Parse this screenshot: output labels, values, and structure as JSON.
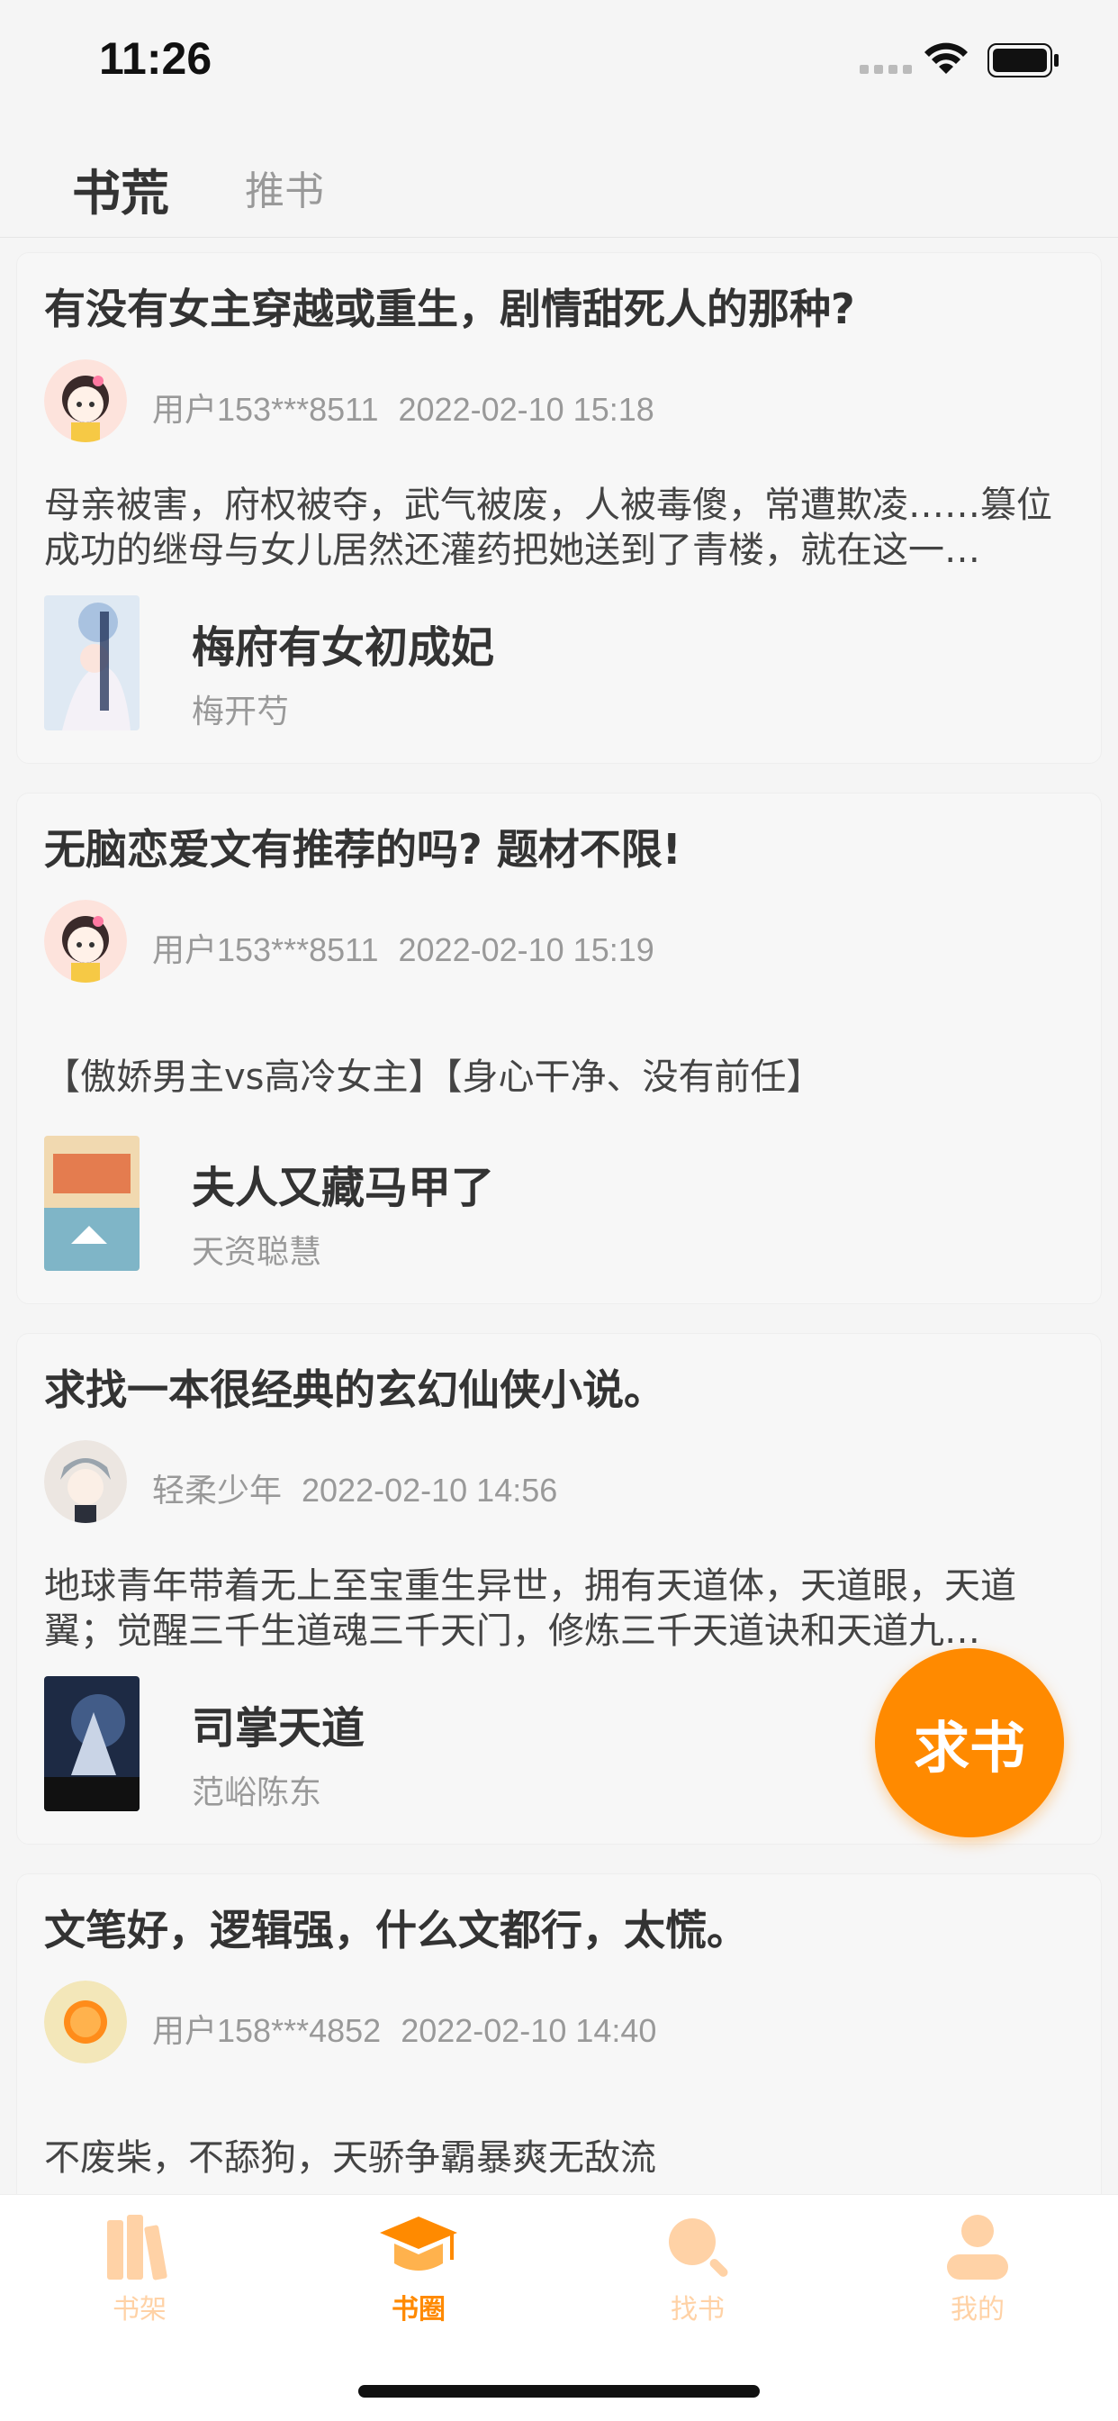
{
  "status_bar": {
    "time": "11:26"
  },
  "header": {
    "tabs": [
      "书荒",
      "推书"
    ],
    "active_tab": 0
  },
  "posts": [
    {
      "title": "有没有女主穿越或重生，剧情甜死人的那种?",
      "user": "用户153***8511",
      "date": "2022-02-10 15:18",
      "excerpt": "母亲被害，府权被夺，武气被废，人被毒傻，常遭欺凌……篡位成功的继母与女儿居然还灌药把她送到了青楼，就在这一…",
      "book": {
        "title": "梅府有女初成妃",
        "author": "梅开芍"
      }
    },
    {
      "title": "无脑恋爱文有推荐的吗? 题材不限!",
      "user": "用户153***8511",
      "date": "2022-02-10 15:19",
      "excerpt": "【傲娇男主vs高冷女主】【身心干净、没有前任】",
      "book": {
        "title": "夫人又藏马甲了",
        "author": "天资聪慧"
      }
    },
    {
      "title": "求找一本很经典的玄幻仙侠小说。",
      "user": "轻柔少年",
      "date": "2022-02-10 14:56",
      "excerpt": "地球青年带着无上至宝重生异世，拥有天道体，天道眼，天道翼；觉醒三千生道魂三千天门，修炼三千天道诀和天道九…",
      "book": {
        "title": "司掌天道",
        "author": "范峪陈东"
      }
    },
    {
      "title": "文笔好，逻辑强，什么文都行，太慌。",
      "user": "用户158***4852",
      "date": "2022-02-10 14:40",
      "excerpt": "不废柴，不舔狗，天骄争霸暴爽无敌流"
    }
  ],
  "fab": {
    "label": "求书"
  },
  "tabbar": {
    "items": [
      {
        "label": "书架",
        "icon": "bookshelf-icon"
      },
      {
        "label": "书圈",
        "icon": "graduation-cap-icon"
      },
      {
        "label": "找书",
        "icon": "search-icon"
      },
      {
        "label": "我的",
        "icon": "user-icon"
      }
    ],
    "active_index": 1
  },
  "colors": {
    "accent": "#ff8a00",
    "accent_light": "#ffd2a6",
    "background": "#f5f5f5"
  }
}
